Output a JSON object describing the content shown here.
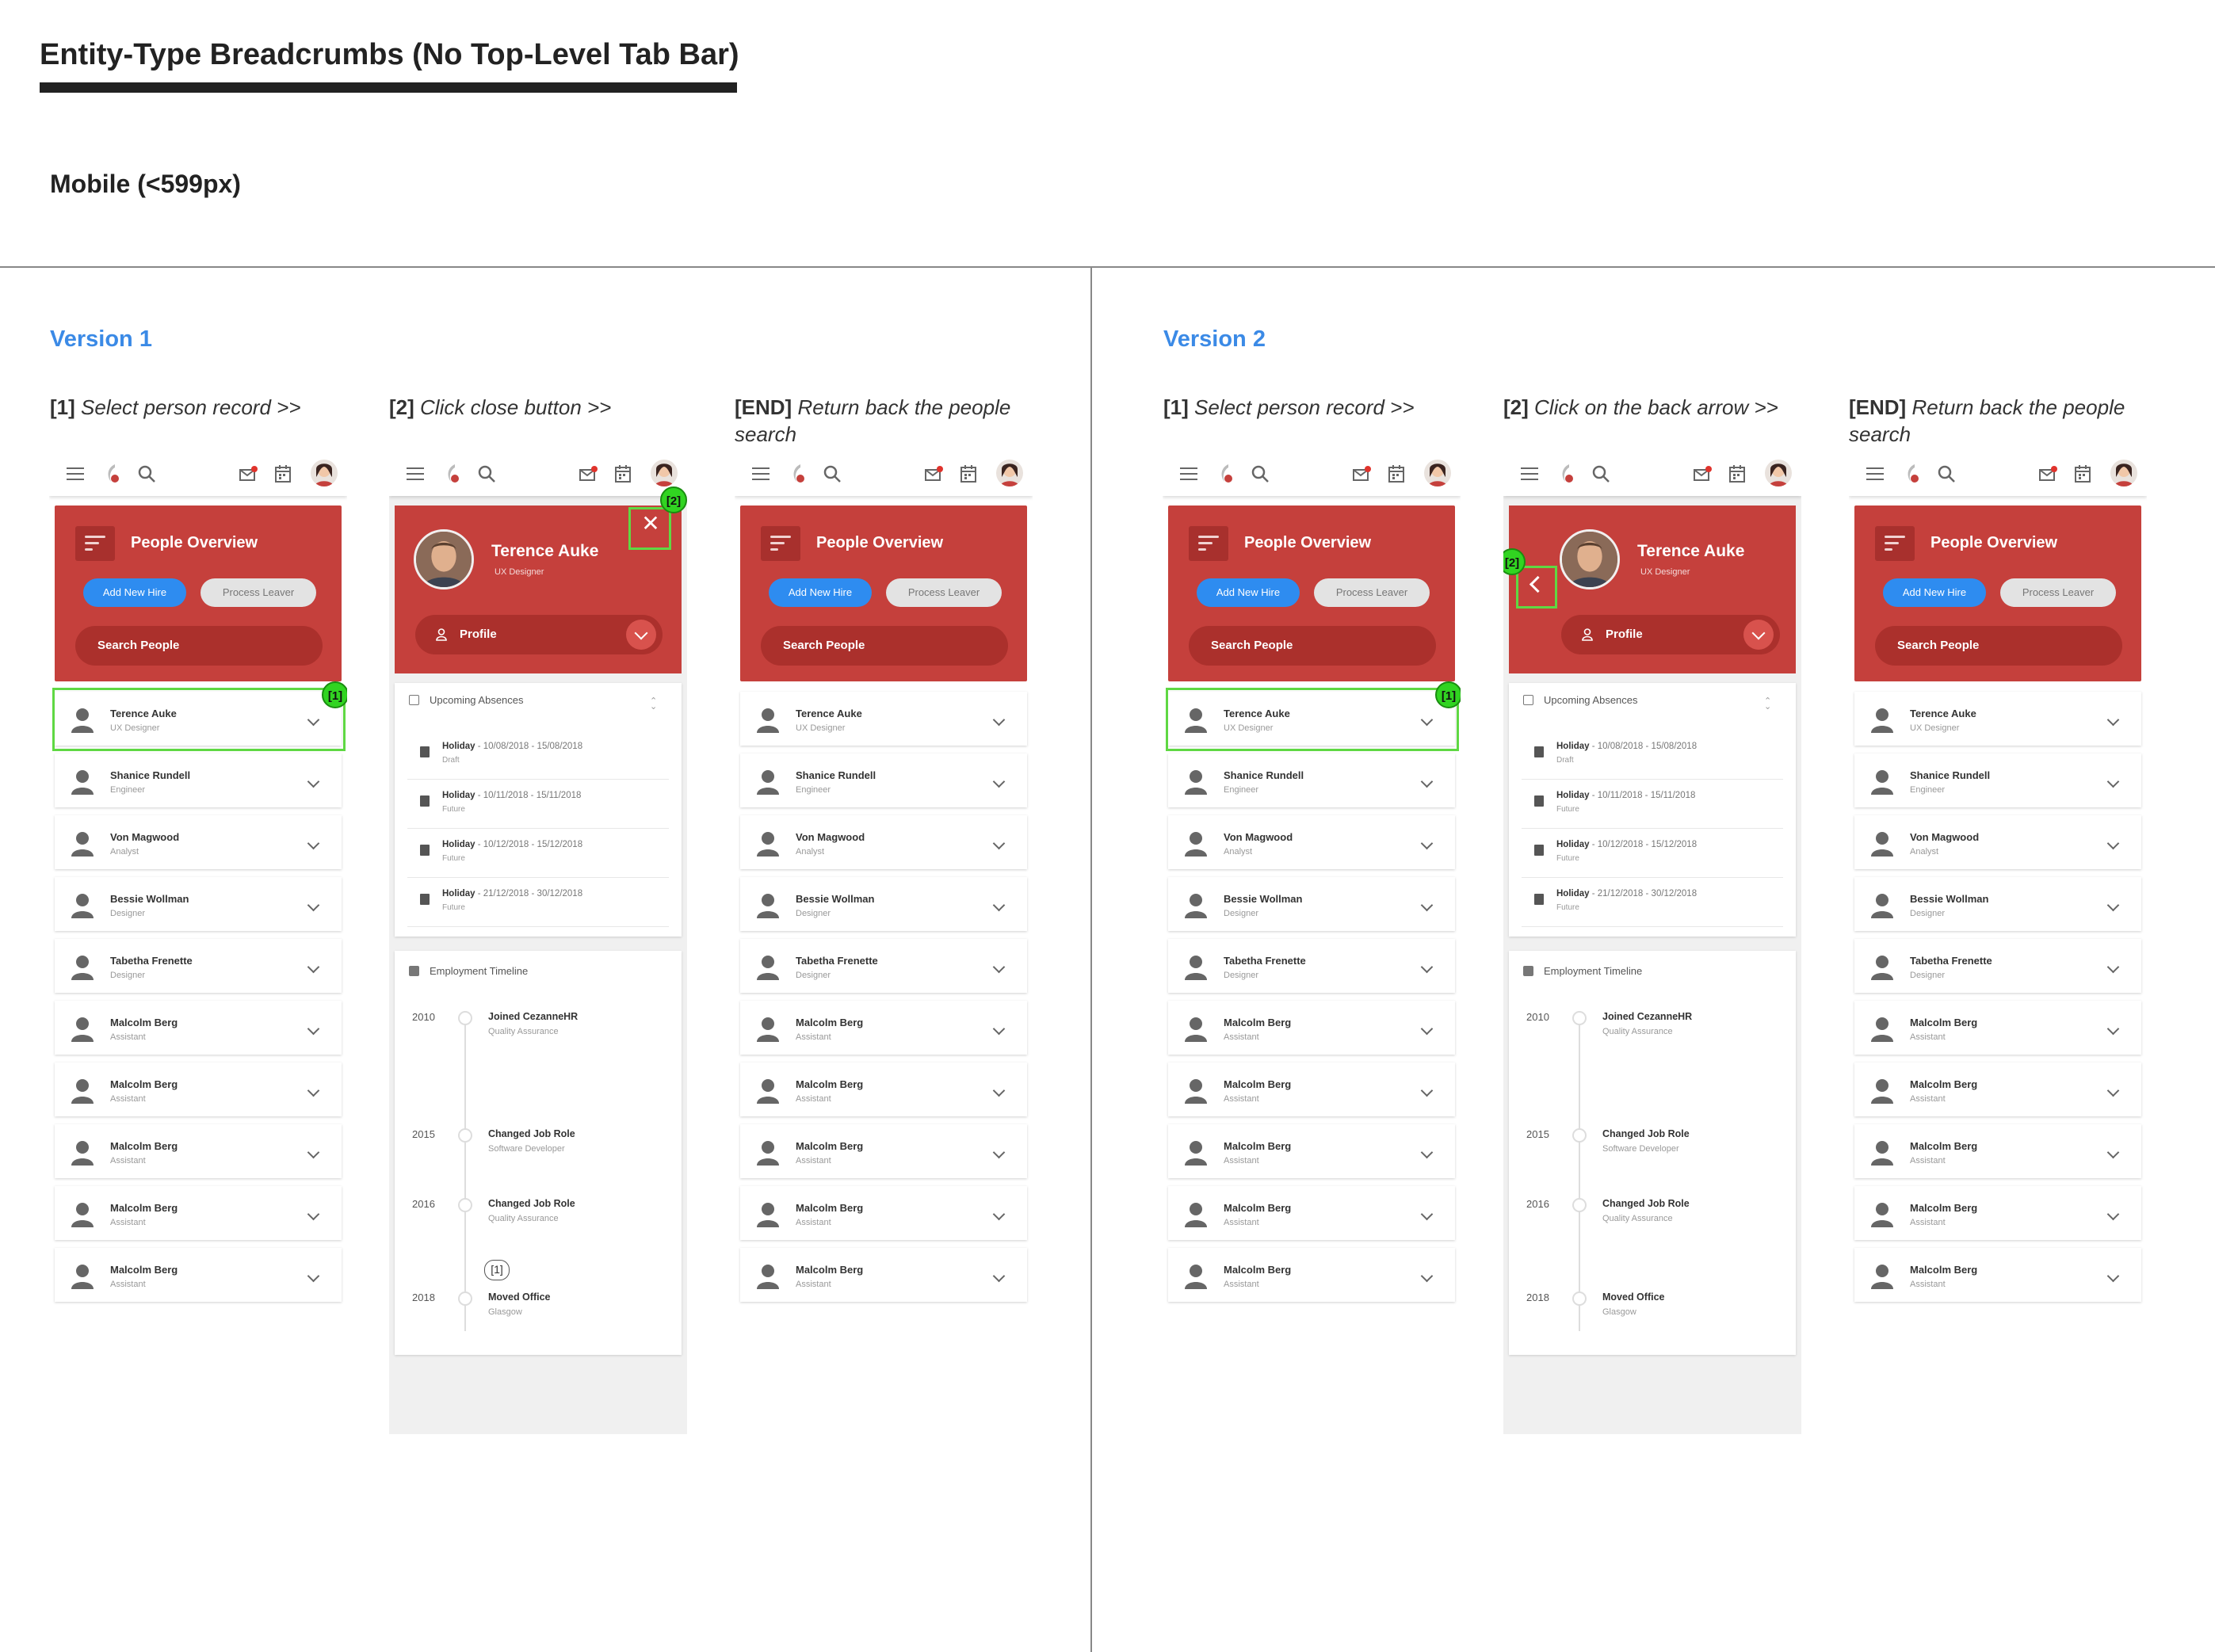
{
  "page_title": "Entity-Type Breadcrumbs (No Top-Level Tab Bar)",
  "subtitle": "Mobile (<599px)",
  "versions": [
    {
      "label": "Version 1",
      "steps": [
        {
          "num": "[1]",
          "text": "Select person record >>"
        },
        {
          "num": "[2]",
          "text": "Click close button  >>"
        },
        {
          "num": "[END]",
          "text": "Return back the people search"
        }
      ]
    },
    {
      "label": "Version 2",
      "steps": [
        {
          "num": "[1]",
          "text": "Select person record >>"
        },
        {
          "num": "[2]",
          "text": "Click on the back arrow  >>"
        },
        {
          "num": "[END]",
          "text": "Return back the people search"
        }
      ]
    }
  ],
  "overview": {
    "title": "People Overview",
    "add_button": "Add New Hire",
    "leaver_button": "Process Leaver",
    "search_label": "Search People"
  },
  "people": [
    {
      "name": "Terence Auke",
      "role": "UX Designer"
    },
    {
      "name": "Shanice Rundell",
      "role": "Engineer"
    },
    {
      "name": "Von Magwood",
      "role": "Analyst"
    },
    {
      "name": "Bessie Wollman",
      "role": "Designer"
    },
    {
      "name": "Tabetha Frenette",
      "role": "Designer"
    },
    {
      "name": "Malcolm Berg",
      "role": "Assistant"
    },
    {
      "name": "Malcolm Berg",
      "role": "Assistant"
    },
    {
      "name": "Malcolm Berg",
      "role": "Assistant"
    },
    {
      "name": "Malcolm Berg",
      "role": "Assistant"
    },
    {
      "name": "Malcolm Berg",
      "role": "Assistant"
    }
  ],
  "profile": {
    "name": "Terence Auke",
    "role": "UX Designer",
    "dropdown_label": "Profile",
    "close_glyph": "✕",
    "absences_title": "Upcoming Absences",
    "absences": [
      {
        "type": "Holiday",
        "dates": " - 10/08/2018 - 15/08/2018",
        "status": "Draft"
      },
      {
        "type": "Holiday",
        "dates": " - 10/11/2018 - 15/11/2018",
        "status": "Future"
      },
      {
        "type": "Holiday",
        "dates": " - 10/12/2018 - 15/12/2018",
        "status": "Future"
      },
      {
        "type": "Holiday",
        "dates": " - 21/12/2018 - 30/12/2018",
        "status": "Future"
      }
    ],
    "timeline_title": "Employment Timeline",
    "timeline": [
      {
        "year": "2010",
        "title": "Joined CezanneHR",
        "sub": "Quality Assurance"
      },
      {
        "year": "2015",
        "title": "Changed Job Role",
        "sub": "Software Developer"
      },
      {
        "year": "2016",
        "title": "Changed Job Role",
        "sub": "Quality Assurance"
      },
      {
        "year": "2018",
        "title": "Moved Office",
        "sub": "Glasgow"
      }
    ],
    "timeline_note": "[1]"
  },
  "annotations": {
    "one": "[1]",
    "two": "[2]"
  },
  "colors": {
    "brand_red": "#c5403c",
    "accent_blue": "#2e8cf0",
    "highlight_green": "#5fd843",
    "version_blue": "#3b8ae6"
  }
}
